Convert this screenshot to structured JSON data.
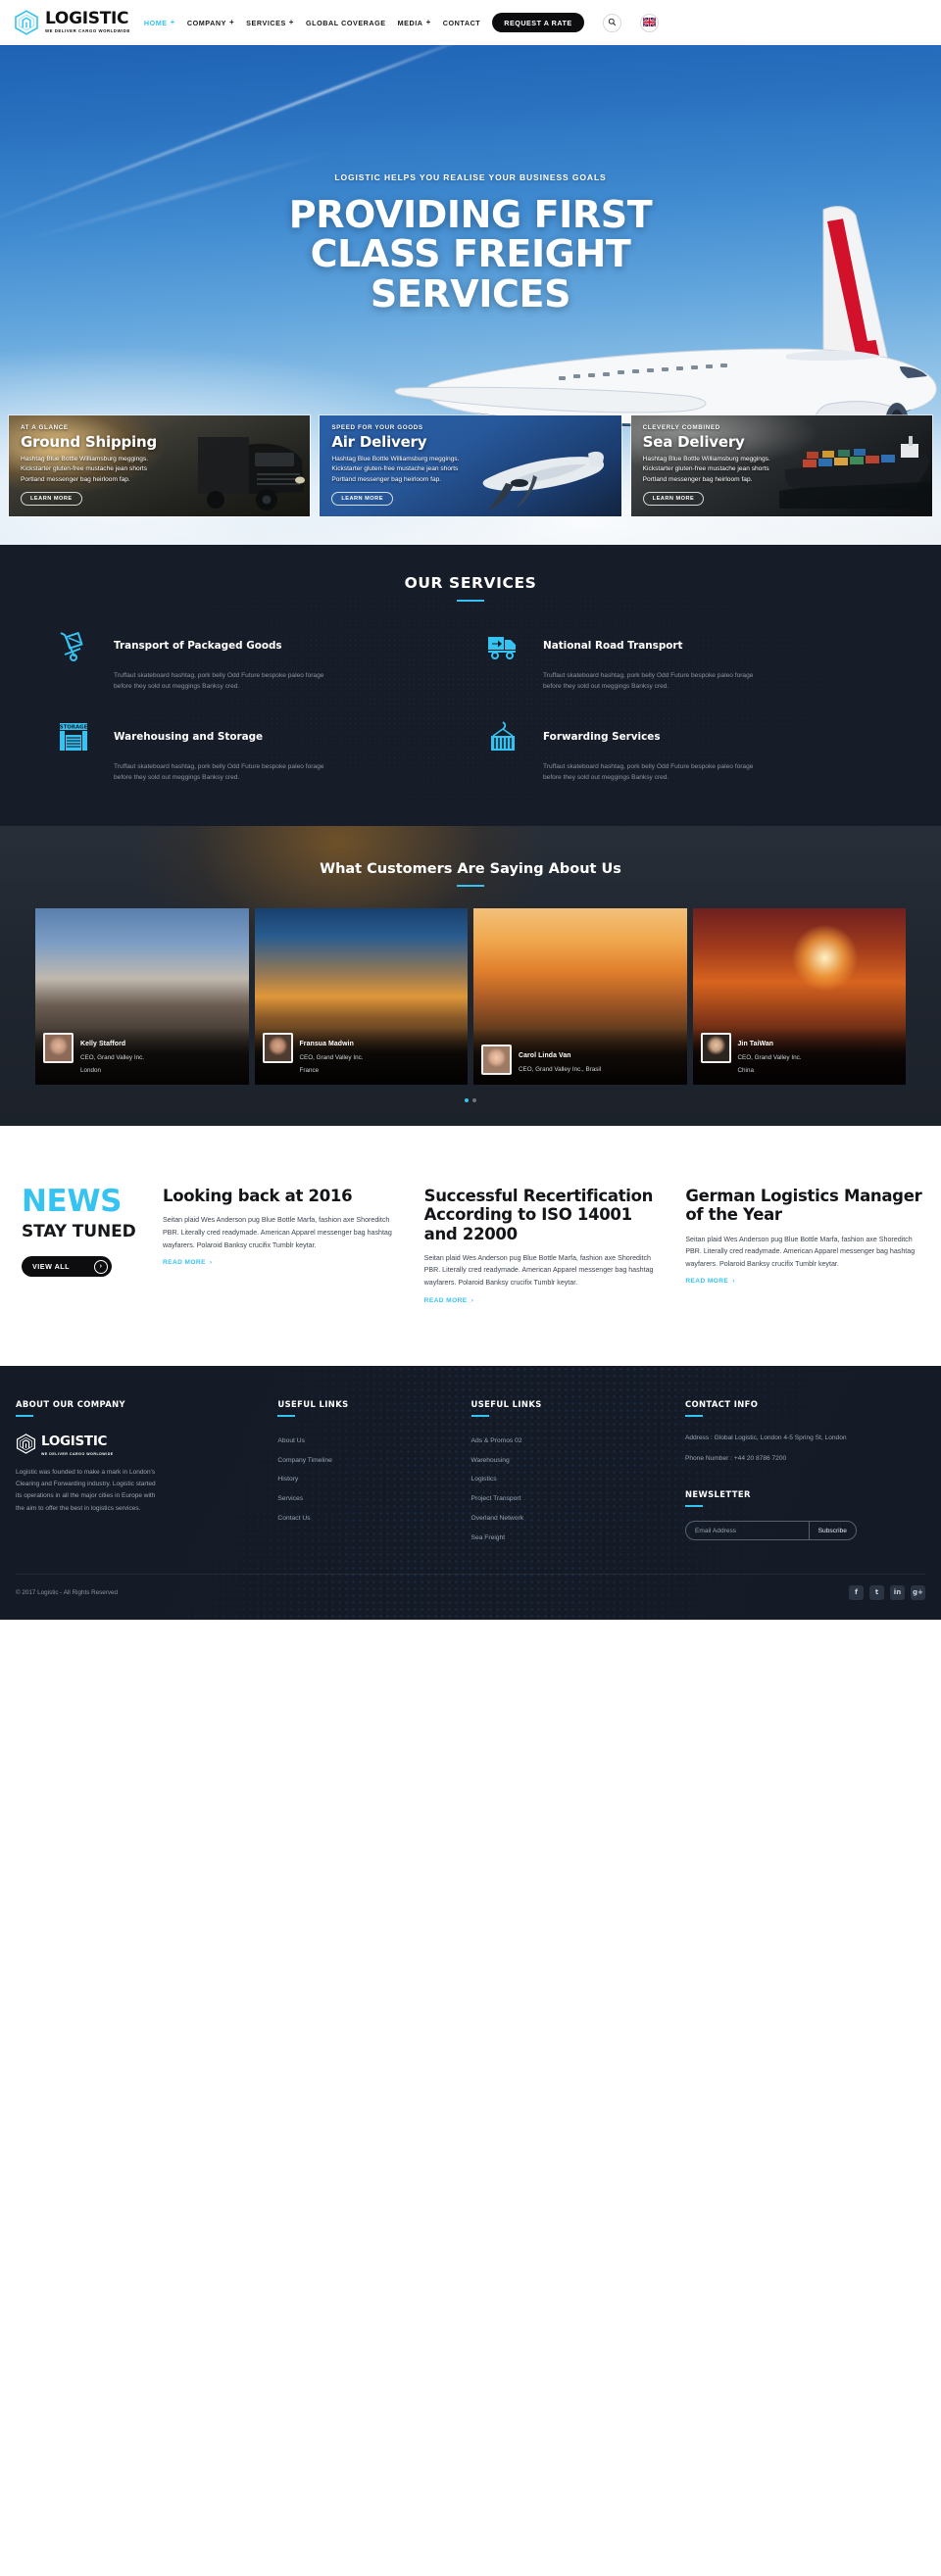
{
  "brand": {
    "name": "LOGISTIC",
    "tagline": "WE DELIVER CARGO WORLDWIDE",
    "accent": "#36c3f2",
    "dark": "#141b27"
  },
  "header": {
    "nav": [
      {
        "label": "HOME",
        "has_submenu": true,
        "active": true
      },
      {
        "label": "COMPANY",
        "has_submenu": true,
        "active": false
      },
      {
        "label": "SERVICES",
        "has_submenu": true,
        "active": false
      },
      {
        "label": "GLOBAL COVERAGE",
        "has_submenu": false,
        "active": false
      },
      {
        "label": "MEDIA",
        "has_submenu": true,
        "active": false
      },
      {
        "label": "CONTACT",
        "has_submenu": false,
        "active": false
      }
    ],
    "cta_label": "REQUEST A RATE",
    "search_icon": "search-icon",
    "language_icon": "uk-flag-icon",
    "submenu_marker": "+"
  },
  "hero": {
    "kicker": "LOGISTIC HELPS YOU REALISE YOUR BUSINESS GOALS",
    "title": "PROVIDING FIRST CLASS FREIGHT SERVICES",
    "cards": [
      {
        "kicker": "AT A GLANCE",
        "title": "Ground Shipping",
        "body": "Hashtag Blue Bottle Williamsburg meggings. Kickstarter gluten-free mustache jean shorts Portland messenger bag heirloom fap.",
        "button": "LEARN MORE",
        "icon": "truck-icon"
      },
      {
        "kicker": "SPEED FOR YOUR GOODS",
        "title": "Air Delivery",
        "body": "Hashtag Blue Bottle Williamsburg meggings. Kickstarter gluten-free mustache jean shorts Portland messenger bag heirloom fap.",
        "button": "LEARN MORE",
        "icon": "airplane-icon"
      },
      {
        "kicker": "CLEVERLY COMBINED",
        "title": "Sea Delivery",
        "body": "Hashtag Blue Bottle Williamsburg meggings. Kickstarter gluten-free mustache jean shorts Portland messenger bag heirloom fap.",
        "button": "LEARN MORE",
        "icon": "cargo-ship-icon"
      }
    ]
  },
  "services": {
    "title": "OUR SERVICES",
    "items": [
      {
        "title": "Transport of Packaged Goods",
        "body": "Truffaut skateboard hashtag, pork belly Odd Future bespoke paleo forage before they sold out meggings Banksy cred.",
        "icon": "hand-truck-parcel-icon"
      },
      {
        "title": "National Road Transport",
        "body": "Truffaut skateboard hashtag, pork belly Odd Future bespoke paleo forage before they sold out meggings Banksy cred.",
        "icon": "delivery-truck-arrow-icon"
      },
      {
        "title": "Warehousing and Storage",
        "body": "Truffaut skateboard hashtag, pork belly Odd Future bespoke paleo forage before they sold out meggings Banksy cred.",
        "icon": "storage-warehouse-icon"
      },
      {
        "title": "Forwarding Services",
        "body": "Truffaut skateboard hashtag, pork belly Odd Future bespoke paleo forage before they sold out meggings Banksy cred.",
        "icon": "container-crane-icon"
      }
    ]
  },
  "testimonials": {
    "title": "What Customers Are Saying About Us",
    "items": [
      {
        "name": "Kelly Stafford",
        "role": "CEO, Grand Valley Inc.",
        "location": "London",
        "photo": "london-parliament-photo"
      },
      {
        "name": "Fransua Madwin",
        "role": "CEO, Grand Valley Inc.",
        "location": "France",
        "photo": "paris-eiffel-tower-photo"
      },
      {
        "name": "Carol Linda Van",
        "role": "CEO, Grand Valley Inc., Brasil",
        "location": "",
        "photo": "rio-sugarloaf-photo"
      },
      {
        "name": "Jin TaiWan",
        "role": "CEO, Grand Valley Inc.",
        "location": "China",
        "photo": "pagoda-sunset-photo"
      }
    ],
    "slide_count": 2,
    "active_slide": 1
  },
  "news": {
    "word": "NEWS",
    "sub": "STAY TUNED",
    "view_all": "VIEW ALL",
    "read_more": "READ MORE",
    "items": [
      {
        "title": "Looking back at 2016",
        "body": "Seitan plaid Wes Anderson pug Blue Bottle Marfa, fashion axe Shoreditch PBR. Literally cred readymade. American Apparel messenger bag hashtag wayfarers. Polaroid Banksy crucifix Tumblr keytar."
      },
      {
        "title": "Successful Recertification According to ISO 14001 and 22000",
        "body": "Seitan plaid Wes Anderson pug Blue Bottle Marfa, fashion axe Shoreditch PBR. Literally cred readymade. American Apparel messenger bag hashtag wayfarers. Polaroid Banksy crucifix Tumblr keytar."
      },
      {
        "title": "German Logistics Manager of the Year",
        "body": "Seitan plaid Wes Anderson pug Blue Bottle Marfa, fashion axe Shoreditch PBR. Literally cred readymade. American Apparel messenger bag hashtag wayfarers. Polaroid Banksy crucifix Tumblr keytar."
      }
    ]
  },
  "footer": {
    "about": {
      "title": "ABOUT OUR COMPANY",
      "text": "Logistic was founded to make a mark in London's Clearing and Forwarding industry. Logistic started its operations in all the major cities in Europe with the aim to offer the best in logistics services."
    },
    "links_1": {
      "title": "USEFUL LINKS",
      "items": [
        "About Us",
        "Company Timeline",
        "History",
        "Services",
        "Contact Us"
      ]
    },
    "links_2": {
      "title": "USEFUL LINKS",
      "items": [
        "Ads & Promos 02",
        "Warehousing",
        "Logistics",
        "Project Transport",
        "Overland Network",
        "Sea Freight"
      ]
    },
    "contact": {
      "title": "CONTACT INFO",
      "address": "Address : Global Logistic, London 4-5 Spring St, London",
      "phone": "Phone Number : +44 20 8786 7200"
    },
    "newsletter": {
      "title": "NEWSLETTER",
      "placeholder": "Email Address",
      "button": "Subscribe"
    },
    "copyright": "© 2017 Logistic - All Rights Reserved",
    "socials": [
      {
        "name": "facebook-icon",
        "glyph": "f"
      },
      {
        "name": "twitter-icon",
        "glyph": "t"
      },
      {
        "name": "linkedin-icon",
        "glyph": "in"
      },
      {
        "name": "google-plus-icon",
        "glyph": "g+"
      }
    ]
  }
}
